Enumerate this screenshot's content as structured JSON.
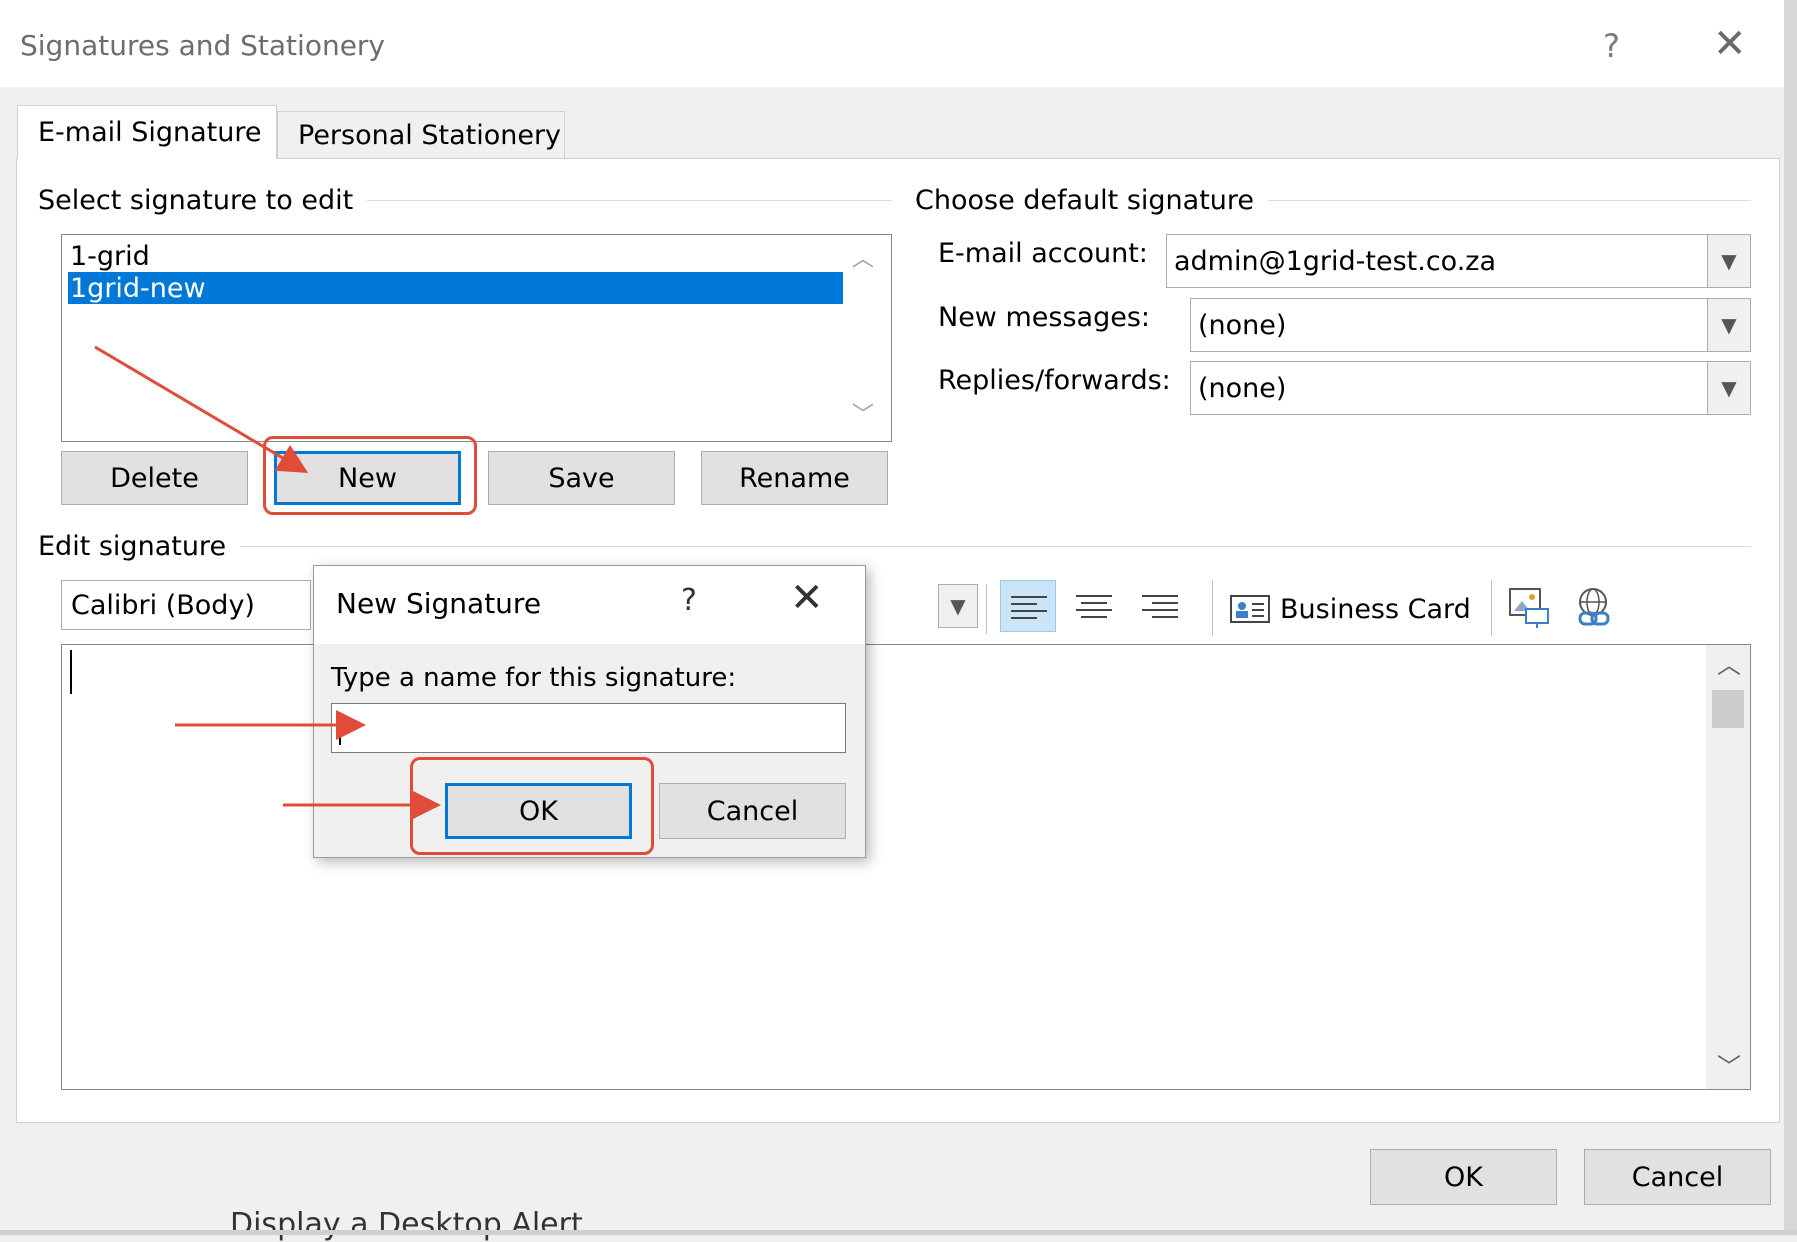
{
  "window": {
    "title": "Signatures and Stationery",
    "help": "?",
    "close": "✕"
  },
  "tabs": [
    {
      "label": "E-mail Signature",
      "accesskey": "E"
    },
    {
      "label": "Personal Stationery",
      "accesskey": "P"
    }
  ],
  "select_group": {
    "header": "Select signature to edit",
    "items": [
      "1-grid",
      "1grid-new"
    ],
    "selected": "1grid-new"
  },
  "sig_buttons": {
    "delete": "Delete",
    "new": "New",
    "save": "Save",
    "rename": "Rename"
  },
  "default_group": {
    "header": "Choose default signature",
    "account_label": "E-mail account:",
    "account_value": "admin@1grid-test.co.za",
    "new_messages_label": "New messages:",
    "new_messages_value": "(none)",
    "replies_label": "Replies/forwards:",
    "replies_value": "(none)"
  },
  "edit_group": {
    "header": "Edit signature",
    "font": "Calibri (Body)",
    "business_card": "Business Card"
  },
  "footer": {
    "ok": "OK",
    "cancel": "Cancel"
  },
  "background_text": "Display a Desktop Alert",
  "new_signature_dialog": {
    "title": "New Signature",
    "help": "?",
    "close": "✕",
    "prompt": "Type a name for this signature:",
    "input_value": "",
    "ok": "OK",
    "cancel": "Cancel"
  },
  "colors": {
    "accent": "#0078d7",
    "annotation": "#e04b3a",
    "selection_text": "#ffffff"
  },
  "icons": [
    "help-icon",
    "close-icon",
    "chevron-down-icon",
    "chevron-up-icon",
    "align-left-icon",
    "align-center-icon",
    "align-right-icon",
    "business-card-icon",
    "insert-picture-icon",
    "insert-hyperlink-icon"
  ]
}
